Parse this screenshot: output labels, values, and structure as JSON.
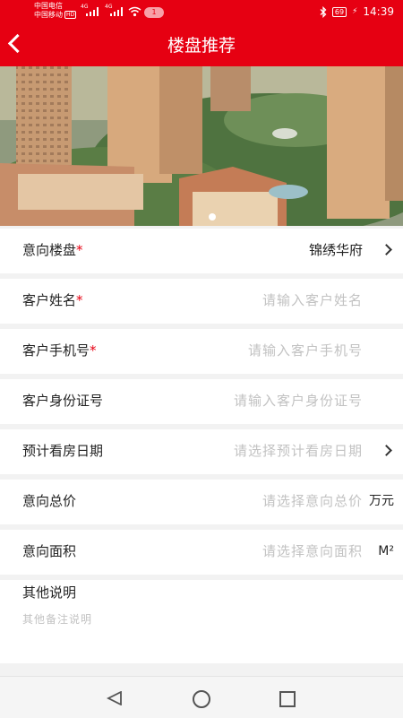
{
  "status_bar": {
    "carrier_1": "中国电信",
    "carrier_2": "中国移动",
    "hd_badge": "HD",
    "net_1": "4G",
    "net_2": "4G",
    "notification_count": "1",
    "battery": "69",
    "time": "14:39"
  },
  "header": {
    "title": "楼盘推荐"
  },
  "form": {
    "property": {
      "label": "意向楼盘",
      "required_mark": "*",
      "value": "锦绣华府"
    },
    "name": {
      "label": "客户姓名",
      "required_mark": "*",
      "placeholder": "请输入客户姓名"
    },
    "phone": {
      "label": "客户手机号",
      "required_mark": "*",
      "placeholder": "请输入客户手机号"
    },
    "id_number": {
      "label": "客户身份证号",
      "placeholder": "请输入客户身份证号"
    },
    "visit_date": {
      "label": "预计看房日期",
      "placeholder": "请选择预计看房日期"
    },
    "total_price": {
      "label": "意向总价",
      "placeholder": "请选择意向总价",
      "unit": "万元"
    },
    "area": {
      "label": "意向面积",
      "placeholder": "请选择意向面积",
      "unit": "M²"
    },
    "other": {
      "label": "其他说明",
      "placeholder": "其他备注说明"
    }
  },
  "colors": {
    "brand_red": "#e60012",
    "placeholder_gray": "#c2c2c2"
  }
}
